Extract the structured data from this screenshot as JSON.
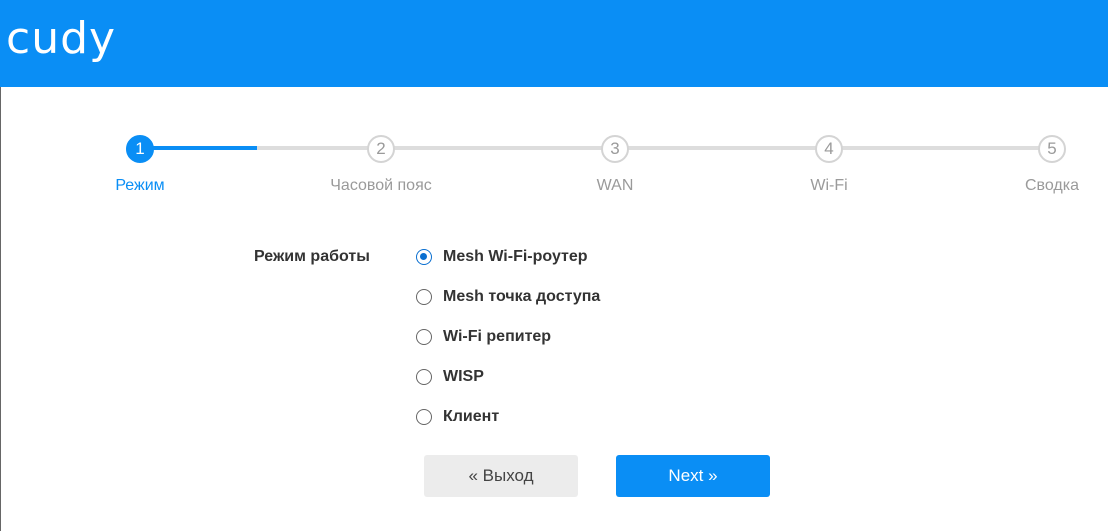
{
  "header": {
    "logo": "cudy",
    "bg_color": "#0a8ef5"
  },
  "stepper": {
    "steps": [
      {
        "number": "1",
        "label": "Режим",
        "active": true
      },
      {
        "number": "2",
        "label": "Часовой пояс",
        "active": false
      },
      {
        "number": "3",
        "label": "WAN",
        "active": false
      },
      {
        "number": "4",
        "label": "Wi-Fi",
        "active": false
      },
      {
        "number": "5",
        "label": "Сводка",
        "active": false
      }
    ],
    "active_color": "#0a8ef5"
  },
  "mode": {
    "label": "Режим работы",
    "selected": "Mesh Wi-Fi-роутер",
    "options": [
      "Mesh Wi-Fi-роутер",
      "Mesh точка доступа",
      "Wi-Fi репитер",
      "WISP",
      "Клиент"
    ]
  },
  "buttons": {
    "exit": "« Выход",
    "next": "Next »"
  }
}
